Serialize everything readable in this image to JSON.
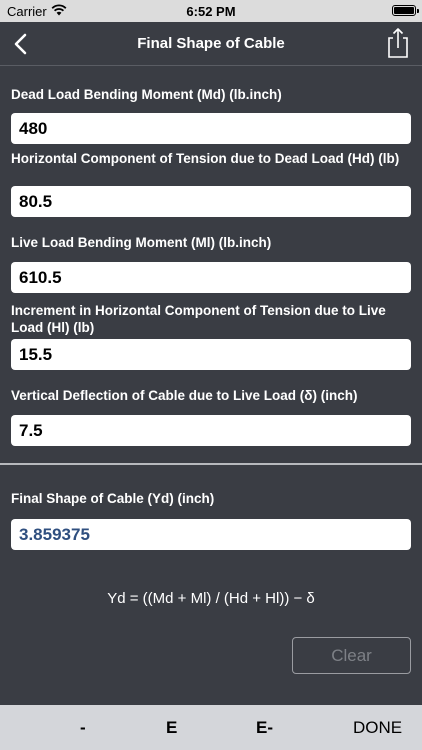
{
  "status_bar": {
    "carrier": "Carrier",
    "time": "6:52 PM"
  },
  "nav": {
    "title": "Final Shape of Cable",
    "back_icon": "chevron-left-icon",
    "share_icon": "share-icon"
  },
  "inputs": [
    {
      "label": "Dead Load Bending Moment (Md) (lb.inch)",
      "value": "480"
    },
    {
      "label": "Horizontal Component of Tension due to Dead Load (Hd) (lb)",
      "value": "80.5"
    },
    {
      "label": "Live Load Bending Moment (Ml) (lb.inch)",
      "value": "610.5"
    },
    {
      "label": "Increment in Horizontal Component of Tension due to Live Load (Hl) (lb)",
      "value": "15.5"
    },
    {
      "label": "Vertical Deflection of Cable due to Live Load (δ) (inch)",
      "value": "7.5"
    }
  ],
  "result": {
    "label": "Final Shape of Cable (Yd) (inch)",
    "value": "3.859375"
  },
  "formula": "Yd = ((Md + Ml) / (Hd + Hl)) − δ",
  "clear_label": "Clear",
  "keyboard_bar": {
    "minus": "-",
    "e": "E",
    "e_minus": "E-",
    "done": "DONE"
  },
  "colors": {
    "background": "#3a3d44",
    "result_text": "#2f4f7f",
    "status_bar": "#dcdcdc",
    "keyboard_bar": "#d4d6da"
  }
}
